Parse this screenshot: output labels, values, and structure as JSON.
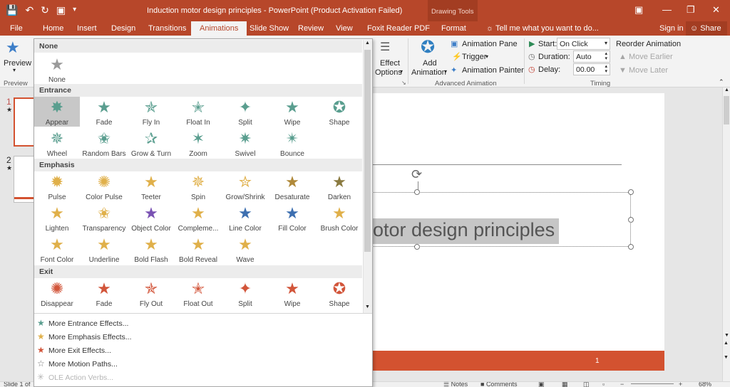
{
  "titlebar": {
    "title": "Induction motor design principles - PowerPoint (Product Activation Failed)",
    "context_group": "Drawing Tools",
    "qat_icons": [
      "save-icon",
      "undo-icon",
      "redo-icon",
      "present-icon",
      "customize-icon"
    ]
  },
  "tabs": [
    "File",
    "Home",
    "Insert",
    "Design",
    "Transitions",
    "Animations",
    "Slide Show",
    "Review",
    "View",
    "Foxit Reader PDF",
    "Format"
  ],
  "active_tab": "Animations",
  "tell_me": "Tell me what you want to do...",
  "sign_in": "Sign in",
  "share": "Share",
  "ribbon": {
    "preview": "Preview",
    "preview_group": "Preview",
    "effect_options_1": "Effect",
    "effect_options_2": "Options",
    "add_animation_1": "Add",
    "add_animation_2": "Animation",
    "animation_pane": "Animation Pane",
    "trigger": "Trigger",
    "animation_painter": "Animation Painter",
    "advanced_group": "Advanced Animation",
    "start_label": "Start:",
    "start_value": "On Click",
    "duration_label": "Duration:",
    "duration_value": "Auto",
    "delay_label": "Delay:",
    "delay_value": "00.00",
    "reorder": "Reorder Animation",
    "move_earlier": "Move Earlier",
    "move_later": "Move Later",
    "timing_group": "Timing"
  },
  "slides": [
    {
      "num": "1",
      "star": "★"
    },
    {
      "num": "2",
      "star": "★"
    }
  ],
  "slide": {
    "title_text": "otor design principles",
    "footer_num": "1"
  },
  "gallery": {
    "none_section": "None",
    "none_item": "None",
    "entrance_section": "Entrance",
    "entrance": [
      "Appear",
      "Fade",
      "Fly In",
      "Float In",
      "Split",
      "Wipe",
      "Shape",
      "Wheel",
      "Random Bars",
      "Grow & Turn",
      "Zoom",
      "Swivel",
      "Bounce"
    ],
    "emphasis_section": "Emphasis",
    "emphasis": [
      "Pulse",
      "Color Pulse",
      "Teeter",
      "Spin",
      "Grow/Shrink",
      "Desaturate",
      "Darken",
      "Lighten",
      "Transparency",
      "Object Color",
      "Compleme...",
      "Line Color",
      "Fill Color",
      "Brush Color",
      "Font Color",
      "Underline",
      "Bold Flash",
      "Bold Reveal",
      "Wave"
    ],
    "exit_section": "Exit",
    "exit": [
      "Disappear",
      "Fade",
      "Fly Out",
      "Float Out",
      "Split",
      "Wipe",
      "Shape"
    ],
    "more": {
      "entrance": "More Entrance Effects...",
      "emphasis": "More Emphasis Effects...",
      "exit": "More Exit Effects...",
      "motion": "More Motion Paths...",
      "ole": "OLE Action Verbs..."
    }
  },
  "status": {
    "slide_of": "Slide 1 of",
    "notes": "Notes",
    "comments": "Comments",
    "zoom": "68%"
  },
  "colors": {
    "accent": "#b7472a",
    "entrance": "#5a9e8f",
    "emphasis": "#e0b04a",
    "exit": "#d2553a"
  }
}
